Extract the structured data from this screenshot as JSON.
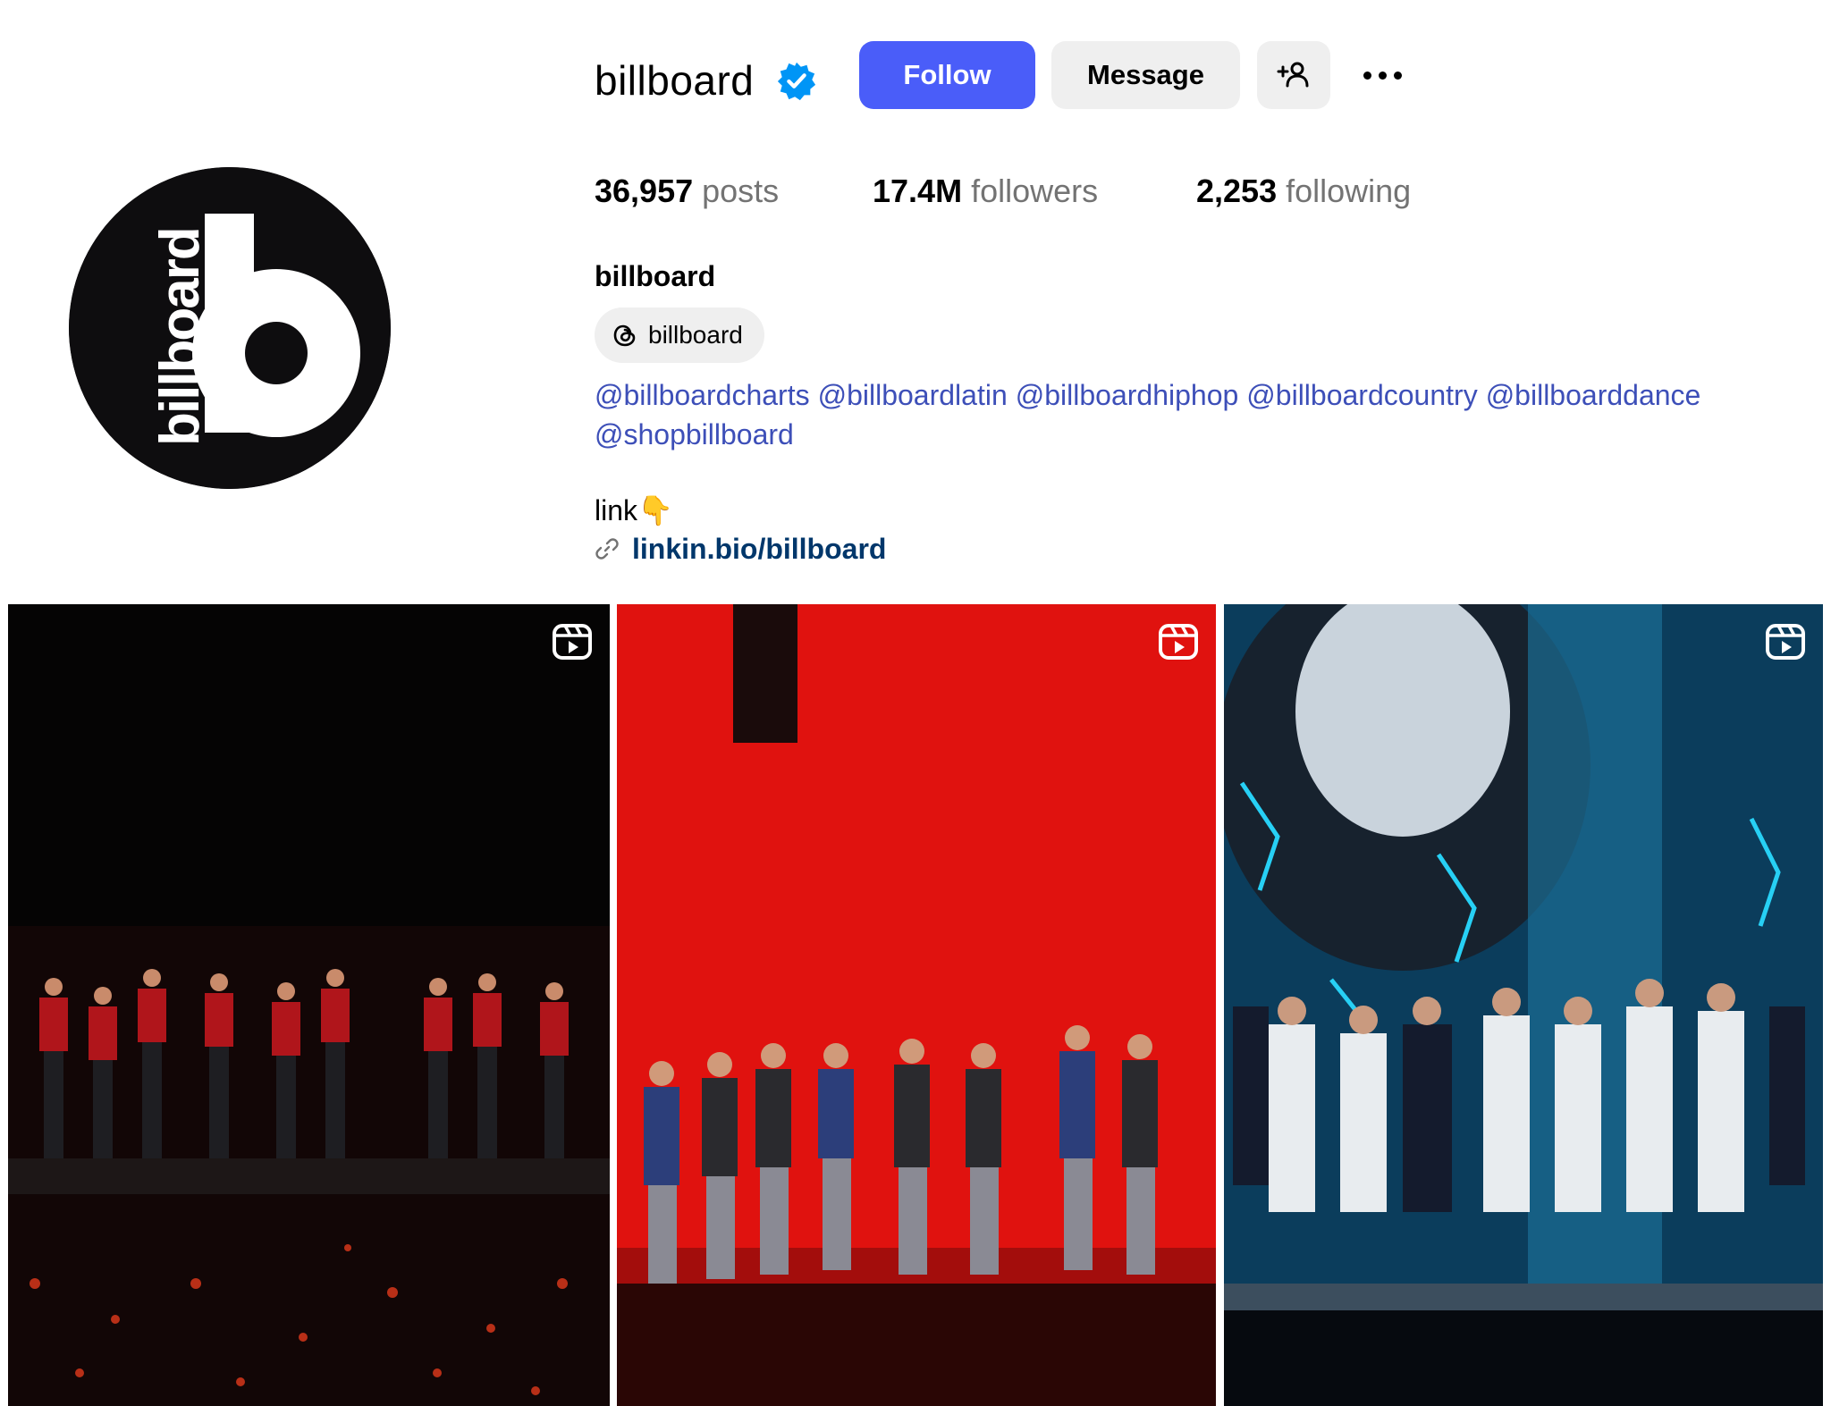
{
  "profile": {
    "username": "billboard",
    "avatar_icon": "billboard-logo",
    "verified_icon": "verified-badge-icon",
    "follow_label": "Follow",
    "message_label": "Message",
    "add_user_icon": "add-user-icon",
    "more_icon": "more-options-icon"
  },
  "stats": [
    {
      "value": "36,957",
      "label": "posts"
    },
    {
      "value": "17.4M",
      "label": "followers"
    },
    {
      "value": "2,253",
      "label": "following"
    }
  ],
  "bio": {
    "name": "billboard",
    "threads_label": "billboard",
    "threads_icon": "threads-icon",
    "mentions": [
      "@billboardcharts",
      "@billboardlatin",
      "@billboardhiphop",
      "@billboardcountry",
      "@billboarddance",
      "@shopbillboard"
    ],
    "link_intro": "link👇",
    "link_icon": "link-icon",
    "link_url": "linkin.bio/billboard"
  },
  "posts": [
    {
      "type": "reel",
      "icon": "reel-icon",
      "scene": "concert-dark-red-jackets"
    },
    {
      "type": "reel",
      "icon": "reel-icon",
      "scene": "concert-red-backdrop"
    },
    {
      "type": "reel",
      "icon": "reel-icon",
      "scene": "concert-blue-white-suits"
    }
  ],
  "colors": {
    "follow_button": "#4a5df9",
    "secondary_button": "#efefef",
    "mention_link": "#3d4fb8",
    "url_link": "#00376b",
    "muted_text": "#737373",
    "verified_blue": "#0095f6"
  }
}
